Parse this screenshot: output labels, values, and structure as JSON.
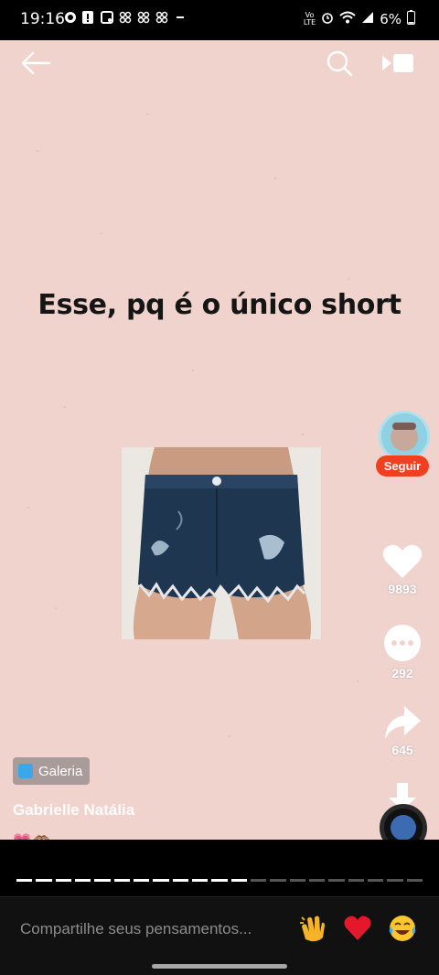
{
  "status_bar": {
    "time": "19:16",
    "battery": "6%",
    "left_icons": [
      "whatsapp-icon",
      "alert-icon",
      "gallery-icon",
      "teams-icon",
      "teams-icon",
      "teams-icon",
      "overflow-icon"
    ],
    "right_icons": [
      "volte-icon",
      "alarm-icon",
      "wifi-icon",
      "signal-icon",
      "battery-icon"
    ]
  },
  "top_nav": {
    "back_icon": "back-arrow-icon",
    "search_icon": "search-icon",
    "video_icon": "video-icon"
  },
  "post": {
    "caption": "Esse, pq é o único short",
    "image_icon": "denim-shorts-photo",
    "source_chip": "Galeria",
    "author": "Gabrielle Natália",
    "emojis": [
      "💗",
      "🫶🏽"
    ]
  },
  "side_rail": {
    "follow_label": "Seguir",
    "likes": "9893",
    "comments": "292",
    "shares": "645"
  },
  "progress": {
    "segments_total": 21,
    "segments_done": 12
  },
  "comment_bar": {
    "placeholder": "Compartilhe seus pensamentos...",
    "reactions": [
      "clap-emoji",
      "heart-emoji",
      "laugh-cry-emoji"
    ]
  },
  "colors": {
    "background": "#f1d3ce",
    "follow": "#f0401f",
    "caption": "#151515"
  }
}
